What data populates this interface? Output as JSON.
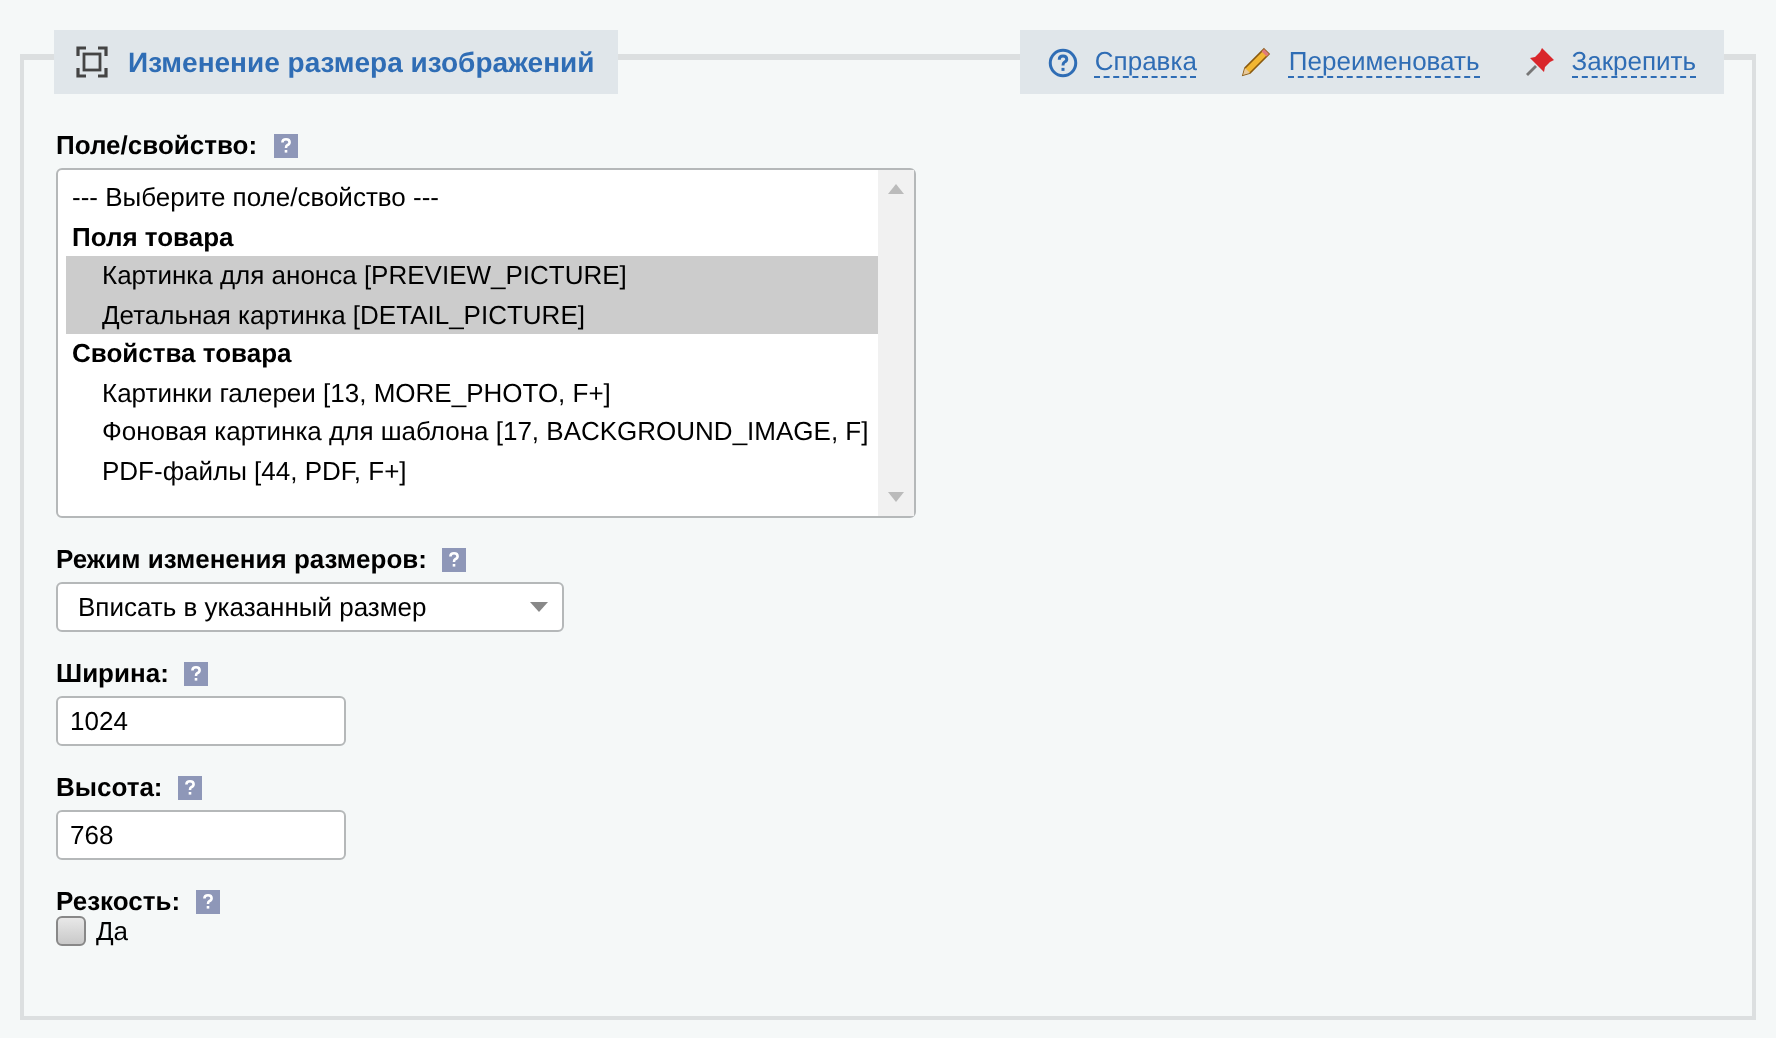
{
  "panel": {
    "title": "Изменение размера изображений",
    "actions": [
      {
        "kind": "help",
        "label": "Справка"
      },
      {
        "kind": "rename",
        "label": "Переименовать"
      },
      {
        "kind": "pin",
        "label": "Закрепить"
      }
    ]
  },
  "fields": [
    {
      "kind": "listbox",
      "label": "Поле/свойство:",
      "options": [
        {
          "kind": "placeholder",
          "text": "--- Выберите поле/свойство ---",
          "selected": false
        },
        {
          "kind": "group",
          "text": "Поля товара"
        },
        {
          "kind": "option",
          "text": "Картинка для анонса [PREVIEW_PICTURE]",
          "selected": true
        },
        {
          "kind": "option",
          "text": "Детальная картинка [DETAIL_PICTURE]",
          "selected": true
        },
        {
          "kind": "group",
          "text": "Свойства товара"
        },
        {
          "kind": "option",
          "text": "Картинки галереи [13, MORE_PHOTO, F+]",
          "selected": false
        },
        {
          "kind": "option",
          "text": "Фоновая картинка для шаблона [17, BACKGROUND_IMAGE, F]",
          "selected": false
        },
        {
          "kind": "option",
          "text": "PDF-файлы [44, PDF, F+]",
          "selected": false
        }
      ]
    },
    {
      "kind": "select",
      "label": "Режим изменения размеров:",
      "value": "Вписать в указанный размер"
    },
    {
      "kind": "input",
      "label": "Ширина:",
      "value": "1024"
    },
    {
      "kind": "input",
      "label": "Высота:",
      "value": "768"
    },
    {
      "kind": "checkbox",
      "label": "Резкость:",
      "option": "Да",
      "checked": false
    }
  ]
}
